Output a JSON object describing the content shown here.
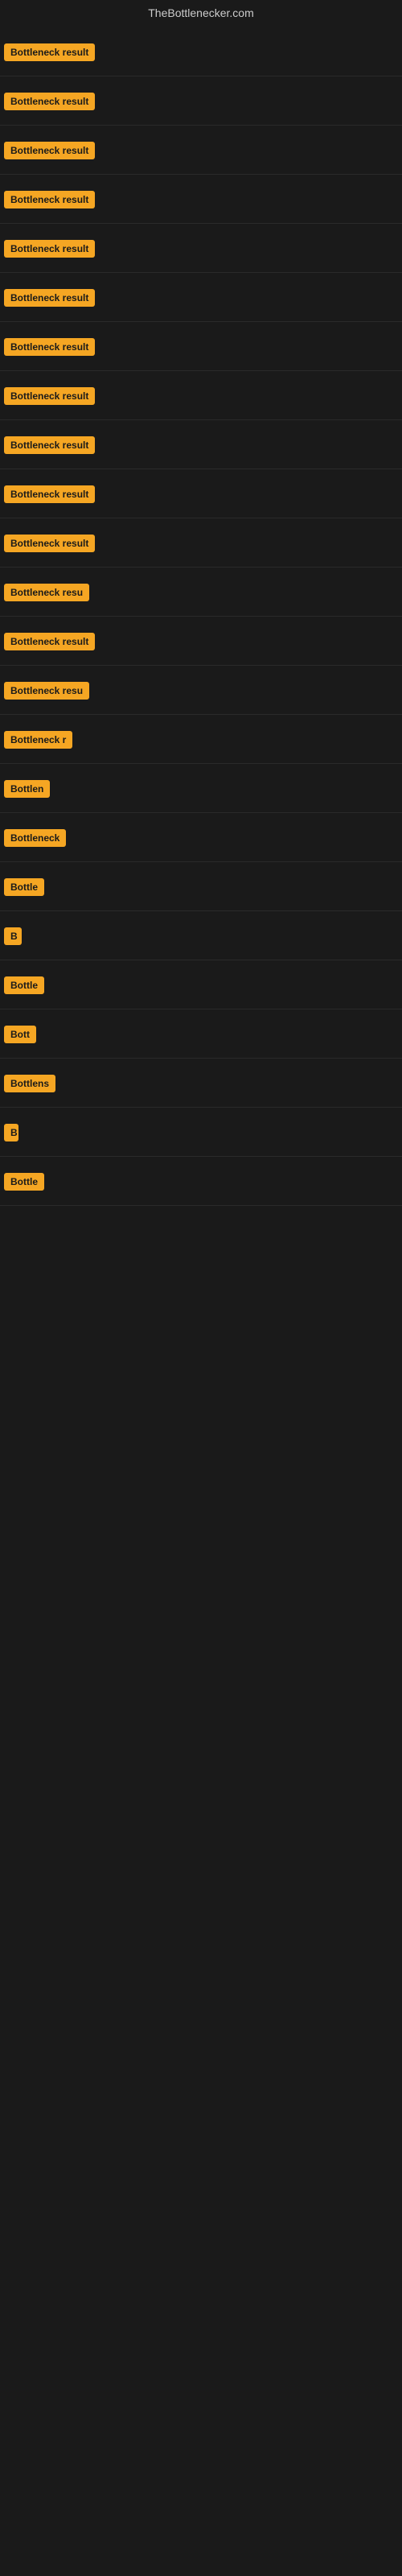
{
  "site": {
    "title": "TheBottlenecker.com"
  },
  "rows": [
    {
      "id": 1,
      "label": "Bottleneck result",
      "badge_width": 155
    },
    {
      "id": 2,
      "label": "Bottleneck result",
      "badge_width": 155
    },
    {
      "id": 3,
      "label": "Bottleneck result",
      "badge_width": 155
    },
    {
      "id": 4,
      "label": "Bottleneck result",
      "badge_width": 155
    },
    {
      "id": 5,
      "label": "Bottleneck result",
      "badge_width": 155
    },
    {
      "id": 6,
      "label": "Bottleneck result",
      "badge_width": 155
    },
    {
      "id": 7,
      "label": "Bottleneck result",
      "badge_width": 155
    },
    {
      "id": 8,
      "label": "Bottleneck result",
      "badge_width": 155
    },
    {
      "id": 9,
      "label": "Bottleneck result",
      "badge_width": 155
    },
    {
      "id": 10,
      "label": "Bottleneck result",
      "badge_width": 155
    },
    {
      "id": 11,
      "label": "Bottleneck result",
      "badge_width": 155
    },
    {
      "id": 12,
      "label": "Bottleneck resu",
      "badge_width": 130
    },
    {
      "id": 13,
      "label": "Bottleneck result",
      "badge_width": 150
    },
    {
      "id": 14,
      "label": "Bottleneck resu",
      "badge_width": 125
    },
    {
      "id": 15,
      "label": "Bottleneck r",
      "badge_width": 100
    },
    {
      "id": 16,
      "label": "Bottlen",
      "badge_width": 75
    },
    {
      "id": 17,
      "label": "Bottleneck",
      "badge_width": 85
    },
    {
      "id": 18,
      "label": "Bottle",
      "badge_width": 65
    },
    {
      "id": 19,
      "label": "B",
      "badge_width": 22
    },
    {
      "id": 20,
      "label": "Bottle",
      "badge_width": 60
    },
    {
      "id": 21,
      "label": "Bott",
      "badge_width": 50
    },
    {
      "id": 22,
      "label": "Bottlens",
      "badge_width": 70
    },
    {
      "id": 23,
      "label": "B",
      "badge_width": 18
    },
    {
      "id": 24,
      "label": "Bottle",
      "badge_width": 60
    }
  ]
}
